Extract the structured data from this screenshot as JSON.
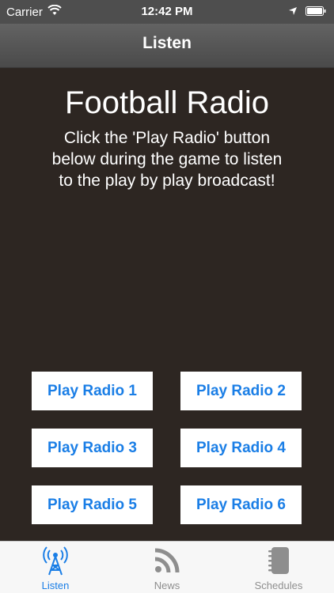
{
  "status_bar": {
    "carrier": "Carrier",
    "time": "12:42 PM",
    "icons": [
      "wifi-icon",
      "location-arrow-icon",
      "battery-icon"
    ]
  },
  "nav": {
    "title": "Listen"
  },
  "main": {
    "headline": "Football Radio",
    "subtitle": "Click the 'Play Radio' button below during the game to listen to the play by play broadcast!",
    "buttons": [
      {
        "label": "Play Radio 1"
      },
      {
        "label": "Play Radio 2"
      },
      {
        "label": "Play Radio 3"
      },
      {
        "label": "Play Radio 4"
      },
      {
        "label": "Play Radio 5"
      },
      {
        "label": "Play Radio 6"
      }
    ]
  },
  "tabbar": {
    "tabs": [
      {
        "label": "Listen",
        "icon": "radio-tower-icon",
        "active": true
      },
      {
        "label": "News",
        "icon": "rss-icon",
        "active": false
      },
      {
        "label": "Schedules",
        "icon": "notebook-icon",
        "active": false
      }
    ]
  },
  "colors": {
    "background": "#2d2622",
    "accent": "#1a7ee6",
    "navbar": "#555555"
  }
}
